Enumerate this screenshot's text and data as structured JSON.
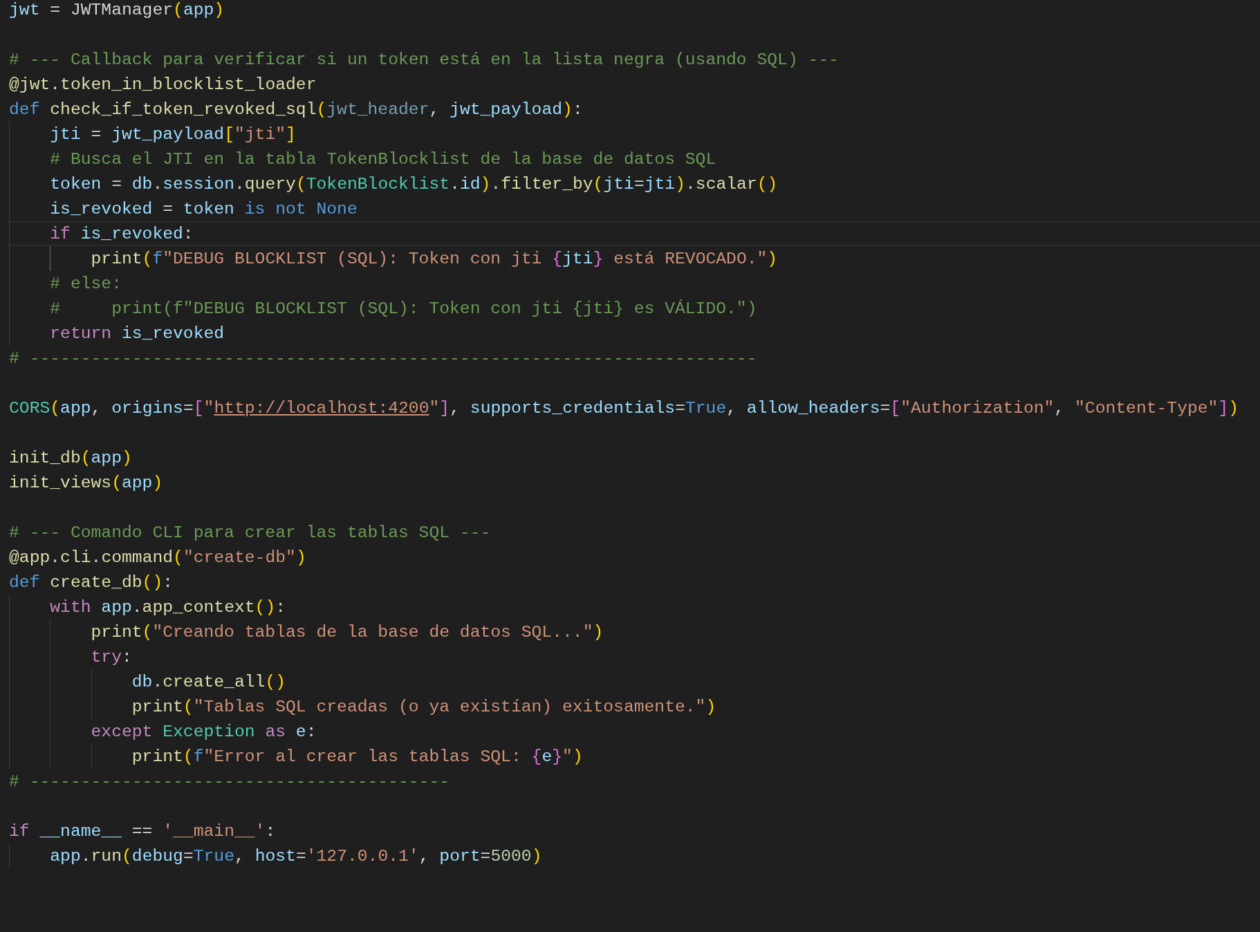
{
  "blocks": [
    {
      "lines": [
        {
          "current": false,
          "tokens": [
            {
              "text": "jwt",
              "kind": "variable"
            },
            {
              "text": " = ",
              "kind": "plain"
            },
            {
              "text": "JWTManager",
              "kind": "plain"
            },
            {
              "text": "(",
              "kind": "bracket1"
            },
            {
              "text": "app",
              "kind": "variable"
            },
            {
              "text": ")",
              "kind": "bracket1"
            }
          ]
        }
      ]
    },
    {
      "lines": [
        {
          "current": false,
          "tokens": [
            {
              "text": "# --- Callback para verificar si un token está en la lista negra (usando SQL) ---",
              "kind": "comment"
            }
          ]
        },
        {
          "current": false,
          "tokens": [
            {
              "text": "@jwt",
              "kind": "function"
            },
            {
              "text": ".",
              "kind": "plain"
            },
            {
              "text": "token_in_blocklist_loader",
              "kind": "function"
            }
          ]
        },
        {
          "current": false,
          "tokens": [
            {
              "text": "def ",
              "kind": "keyword"
            },
            {
              "text": "check_if_token_revoked_sql",
              "kind": "function"
            },
            {
              "text": "(",
              "kind": "bracket1"
            },
            {
              "text": "jwt_header",
              "kind": "unused"
            },
            {
              "text": ", ",
              "kind": "plain"
            },
            {
              "text": "jwt_payload",
              "kind": "variable"
            },
            {
              "text": ")",
              "kind": "bracket1"
            },
            {
              "text": ":",
              "kind": "plain"
            }
          ],
          "children": [
            {
              "current": false,
              "tokens": [
                {
                  "text": "jti",
                  "kind": "variable"
                },
                {
                  "text": " = ",
                  "kind": "plain"
                },
                {
                  "text": "jwt_payload",
                  "kind": "variable"
                },
                {
                  "text": "[",
                  "kind": "bracket1"
                },
                {
                  "text": "\"jti\"",
                  "kind": "string"
                },
                {
                  "text": "]",
                  "kind": "bracket1"
                }
              ]
            },
            {
              "current": false,
              "tokens": [
                {
                  "text": "# Busca el JTI en la tabla TokenBlocklist de la base de datos SQL",
                  "kind": "comment"
                }
              ]
            },
            {
              "current": false,
              "tokens": [
                {
                  "text": "token",
                  "kind": "variable"
                },
                {
                  "text": " = ",
                  "kind": "plain"
                },
                {
                  "text": "db",
                  "kind": "variable"
                },
                {
                  "text": ".",
                  "kind": "plain"
                },
                {
                  "text": "session",
                  "kind": "variable"
                },
                {
                  "text": ".",
                  "kind": "plain"
                },
                {
                  "text": "query",
                  "kind": "function"
                },
                {
                  "text": "(",
                  "kind": "bracket1"
                },
                {
                  "text": "TokenBlocklist",
                  "kind": "class"
                },
                {
                  "text": ".",
                  "kind": "plain"
                },
                {
                  "text": "id",
                  "kind": "variable"
                },
                {
                  "text": ")",
                  "kind": "bracket1"
                },
                {
                  "text": ".",
                  "kind": "plain"
                },
                {
                  "text": "filter_by",
                  "kind": "function"
                },
                {
                  "text": "(",
                  "kind": "bracket1"
                },
                {
                  "text": "jti",
                  "kind": "variable"
                },
                {
                  "text": "=",
                  "kind": "plain"
                },
                {
                  "text": "jti",
                  "kind": "variable"
                },
                {
                  "text": ")",
                  "kind": "bracket1"
                },
                {
                  "text": ".",
                  "kind": "plain"
                },
                {
                  "text": "scalar",
                  "kind": "function"
                },
                {
                  "text": "()",
                  "kind": "bracket1"
                }
              ]
            },
            {
              "current": false,
              "tokens": [
                {
                  "text": "is_revoked",
                  "kind": "variable"
                },
                {
                  "text": " = ",
                  "kind": "plain"
                },
                {
                  "text": "token ",
                  "kind": "variable"
                },
                {
                  "text": "is not ",
                  "kind": "keyword"
                },
                {
                  "text": "None",
                  "kind": "keyword"
                }
              ]
            },
            {
              "current": true,
              "tokens": [
                {
                  "text": "if ",
                  "kind": "control"
                },
                {
                  "text": "is_revoked",
                  "kind": "variable"
                },
                {
                  "text": ":",
                  "kind": "plain"
                }
              ],
              "children": [
                {
                  "current": false,
                  "tokens": [
                    {
                      "text": "print",
                      "kind": "function"
                    },
                    {
                      "text": "(",
                      "kind": "bracket1"
                    },
                    {
                      "text": "f",
                      "kind": "keyword"
                    },
                    {
                      "text": "\"DEBUG BLOCKLIST (SQL): Token con jti ",
                      "kind": "string"
                    },
                    {
                      "text": "{",
                      "kind": "bracket2"
                    },
                    {
                      "text": "jti",
                      "kind": "variable"
                    },
                    {
                      "text": "}",
                      "kind": "bracket2"
                    },
                    {
                      "text": " está REVOCADO.\"",
                      "kind": "string"
                    },
                    {
                      "text": ")",
                      "kind": "bracket1"
                    }
                  ]
                }
              ]
            },
            {
              "current": false,
              "tokens": [
                {
                  "text": "# else:",
                  "kind": "comment"
                }
              ]
            },
            {
              "current": false,
              "tokens": [
                {
                  "text": "#     print(f\"DEBUG BLOCKLIST (SQL): Token con jti {jti} es VÁLIDO.\")",
                  "kind": "comment"
                }
              ]
            },
            {
              "current": false,
              "tokens": [
                {
                  "text": "return ",
                  "kind": "control"
                },
                {
                  "text": "is_revoked",
                  "kind": "variable"
                }
              ]
            }
          ]
        },
        {
          "current": false,
          "tokens": [
            {
              "text": "# -----------------------------------------------------------------------",
              "kind": "comment"
            }
          ]
        }
      ]
    },
    {
      "lines": [
        {
          "current": false,
          "tokens": [
            {
              "text": "CORS",
              "kind": "class"
            },
            {
              "text": "(",
              "kind": "bracket1"
            },
            {
              "text": "app",
              "kind": "variable"
            },
            {
              "text": ", ",
              "kind": "plain"
            },
            {
              "text": "origins",
              "kind": "variable"
            },
            {
              "text": "=",
              "kind": "plain"
            },
            {
              "text": "[",
              "kind": "bracket2"
            },
            {
              "text": "\"",
              "kind": "string"
            },
            {
              "text": "http://localhost:4200",
              "kind": "link"
            },
            {
              "text": "\"",
              "kind": "string"
            },
            {
              "text": "]",
              "kind": "bracket2"
            },
            {
              "text": ", ",
              "kind": "plain"
            },
            {
              "text": "supports_credentials",
              "kind": "variable"
            },
            {
              "text": "=",
              "kind": "plain"
            },
            {
              "text": "True",
              "kind": "keyword"
            },
            {
              "text": ", ",
              "kind": "plain"
            },
            {
              "text": "allow_headers",
              "kind": "variable"
            },
            {
              "text": "=",
              "kind": "plain"
            },
            {
              "text": "[",
              "kind": "bracket2"
            },
            {
              "text": "\"Authorization\"",
              "kind": "string"
            },
            {
              "text": ", ",
              "kind": "plain"
            },
            {
              "text": "\"Content-Type\"",
              "kind": "string"
            },
            {
              "text": "]",
              "kind": "bracket2"
            },
            {
              "text": ")",
              "kind": "bracket1"
            }
          ]
        }
      ]
    },
    {
      "lines": [
        {
          "current": false,
          "tokens": [
            {
              "text": "init_db",
              "kind": "function"
            },
            {
              "text": "(",
              "kind": "bracket1"
            },
            {
              "text": "app",
              "kind": "variable"
            },
            {
              "text": ")",
              "kind": "bracket1"
            }
          ]
        },
        {
          "current": false,
          "tokens": [
            {
              "text": "init_views",
              "kind": "function"
            },
            {
              "text": "(",
              "kind": "bracket1"
            },
            {
              "text": "app",
              "kind": "variable"
            },
            {
              "text": ")",
              "kind": "bracket1"
            }
          ]
        }
      ]
    },
    {
      "lines": [
        {
          "current": false,
          "tokens": [
            {
              "text": "# --- Comando CLI para crear las tablas SQL ---",
              "kind": "comment"
            }
          ]
        },
        {
          "current": false,
          "tokens": [
            {
              "text": "@app",
              "kind": "function"
            },
            {
              "text": ".",
              "kind": "plain"
            },
            {
              "text": "cli",
              "kind": "function"
            },
            {
              "text": ".",
              "kind": "plain"
            },
            {
              "text": "command",
              "kind": "function"
            },
            {
              "text": "(",
              "kind": "bracket1"
            },
            {
              "text": "\"create-db\"",
              "kind": "string"
            },
            {
              "text": ")",
              "kind": "bracket1"
            }
          ]
        },
        {
          "current": false,
          "tokens": [
            {
              "text": "def ",
              "kind": "keyword"
            },
            {
              "text": "create_db",
              "kind": "function"
            },
            {
              "text": "()",
              "kind": "bracket1"
            },
            {
              "text": ":",
              "kind": "plain"
            }
          ],
          "children": [
            {
              "current": false,
              "tokens": [
                {
                  "text": "with ",
                  "kind": "control"
                },
                {
                  "text": "app",
                  "kind": "variable"
                },
                {
                  "text": ".",
                  "kind": "plain"
                },
                {
                  "text": "app_context",
                  "kind": "function"
                },
                {
                  "text": "()",
                  "kind": "bracket1"
                },
                {
                  "text": ":",
                  "kind": "plain"
                }
              ],
              "children": [
                {
                  "current": false,
                  "tokens": [
                    {
                      "text": "print",
                      "kind": "function"
                    },
                    {
                      "text": "(",
                      "kind": "bracket1"
                    },
                    {
                      "text": "\"Creando tablas de la base de datos SQL...\"",
                      "kind": "string"
                    },
                    {
                      "text": ")",
                      "kind": "bracket1"
                    }
                  ]
                },
                {
                  "current": false,
                  "tokens": [
                    {
                      "text": "try",
                      "kind": "control"
                    },
                    {
                      "text": ":",
                      "kind": "plain"
                    }
                  ],
                  "children": [
                    {
                      "current": false,
                      "tokens": [
                        {
                          "text": "db",
                          "kind": "variable"
                        },
                        {
                          "text": ".",
                          "kind": "plain"
                        },
                        {
                          "text": "create_all",
                          "kind": "function"
                        },
                        {
                          "text": "()",
                          "kind": "bracket1"
                        }
                      ]
                    },
                    {
                      "current": false,
                      "tokens": [
                        {
                          "text": "print",
                          "kind": "function"
                        },
                        {
                          "text": "(",
                          "kind": "bracket1"
                        },
                        {
                          "text": "\"Tablas SQL creadas (o ya existían) exitosamente.\"",
                          "kind": "string"
                        },
                        {
                          "text": ")",
                          "kind": "bracket1"
                        }
                      ]
                    }
                  ]
                },
                {
                  "current": false,
                  "tokens": [
                    {
                      "text": "except ",
                      "kind": "control"
                    },
                    {
                      "text": "Exception ",
                      "kind": "class"
                    },
                    {
                      "text": "as ",
                      "kind": "control"
                    },
                    {
                      "text": "e",
                      "kind": "variable"
                    },
                    {
                      "text": ":",
                      "kind": "plain"
                    }
                  ],
                  "children": [
                    {
                      "current": false,
                      "tokens": [
                        {
                          "text": "print",
                          "kind": "function"
                        },
                        {
                          "text": "(",
                          "kind": "bracket1"
                        },
                        {
                          "text": "f",
                          "kind": "keyword"
                        },
                        {
                          "text": "\"Error al crear las tablas SQL: ",
                          "kind": "string"
                        },
                        {
                          "text": "{",
                          "kind": "bracket2"
                        },
                        {
                          "text": "e",
                          "kind": "variable"
                        },
                        {
                          "text": "}",
                          "kind": "bracket2"
                        },
                        {
                          "text": "\"",
                          "kind": "string"
                        },
                        {
                          "text": ")",
                          "kind": "bracket1"
                        }
                      ]
                    }
                  ]
                }
              ]
            }
          ]
        },
        {
          "current": false,
          "tokens": [
            {
              "text": "# -----------------------------------------",
              "kind": "comment"
            }
          ]
        }
      ]
    },
    {
      "lines": [
        {
          "current": false,
          "tokens": [
            {
              "text": "if ",
              "kind": "control"
            },
            {
              "text": "__name__",
              "kind": "variable"
            },
            {
              "text": " == ",
              "kind": "plain"
            },
            {
              "text": "'__main__'",
              "kind": "string"
            },
            {
              "text": ":",
              "kind": "plain"
            }
          ],
          "children": [
            {
              "current": false,
              "tokens": [
                {
                  "text": "app",
                  "kind": "variable"
                },
                {
                  "text": ".",
                  "kind": "plain"
                },
                {
                  "text": "run",
                  "kind": "function"
                },
                {
                  "text": "(",
                  "kind": "bracket1"
                },
                {
                  "text": "debug",
                  "kind": "variable"
                },
                {
                  "text": "=",
                  "kind": "plain"
                },
                {
                  "text": "True",
                  "kind": "keyword"
                },
                {
                  "text": ", ",
                  "kind": "plain"
                },
                {
                  "text": "host",
                  "kind": "variable"
                },
                {
                  "text": "=",
                  "kind": "plain"
                },
                {
                  "text": "'127.0.0.1'",
                  "kind": "string"
                },
                {
                  "text": ", ",
                  "kind": "plain"
                },
                {
                  "text": "port",
                  "kind": "variable"
                },
                {
                  "text": "=",
                  "kind": "plain"
                },
                {
                  "text": "5000",
                  "kind": "number"
                },
                {
                  "text": ")",
                  "kind": "bracket1"
                }
              ]
            }
          ]
        }
      ]
    }
  ]
}
